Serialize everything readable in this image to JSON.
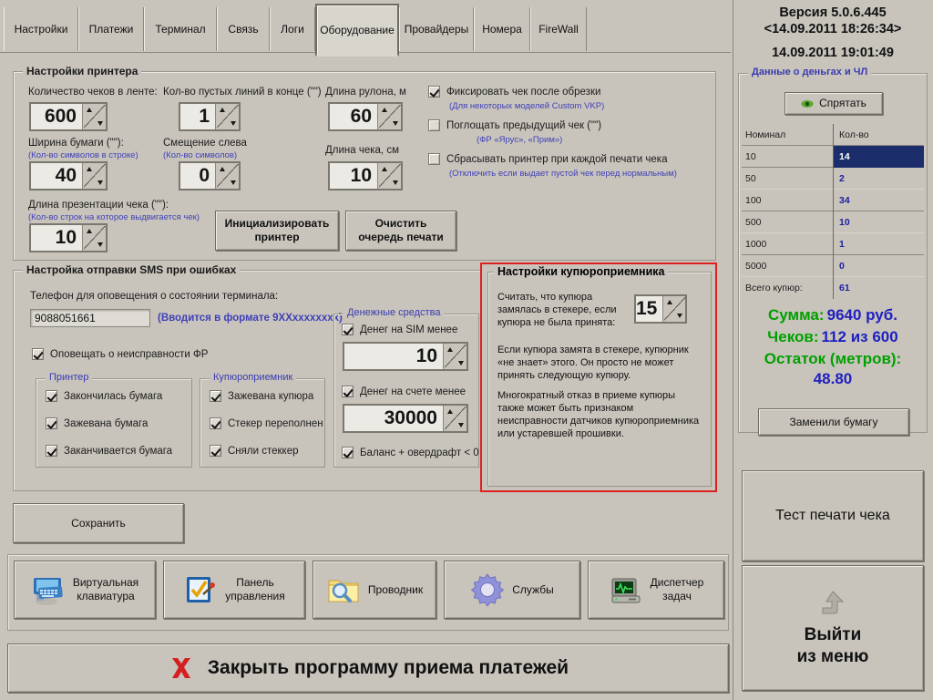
{
  "tabs": [
    {
      "label": "Настройки",
      "selected": false
    },
    {
      "label": "Платежи",
      "selected": false
    },
    {
      "label": "Терминал",
      "selected": false
    },
    {
      "label": "Связь",
      "selected": false
    },
    {
      "label": "Логи",
      "selected": false
    },
    {
      "label": "Оборудование",
      "selected": true
    },
    {
      "label": "Провайдеры",
      "selected": false
    },
    {
      "label": "Номера",
      "selected": false
    },
    {
      "label": "FireWall",
      "selected": false
    }
  ],
  "printer": {
    "title": "Настройки принтера",
    "fields": [
      {
        "label": "Количество чеков в ленте:",
        "sub": "",
        "value": "600"
      },
      {
        "label": "Кол-во пустых линий в конце (\"\")",
        "sub": "",
        "value": "1"
      },
      {
        "label": "Длина рулона, м",
        "sub": "",
        "value": "60"
      },
      {
        "label": "Ширина бумаги (\"\"):",
        "sub": "(Кол-во символов в строке)",
        "value": "40"
      },
      {
        "label": "Смещение слева",
        "sub": "(Кол-во символов)",
        "value": "0"
      },
      {
        "label": "Длина чека, см",
        "sub": "",
        "value": "10"
      },
      {
        "label": "Длина презентации чека (\"\"):",
        "sub": "(Кол-во строк на которое выдвигается чек)",
        "value": "10"
      }
    ],
    "checks": [
      {
        "label": "Фиксировать чек после обрезки",
        "sub": "(Для некоторых моделей Custom VKP)",
        "checked": true
      },
      {
        "label": "Поглощать предыдущий чек (\"\")",
        "sub": "(ФР «Ярус», «Прим»)",
        "checked": false
      },
      {
        "label": "Сбрасывать принтер при каждой печати чека",
        "sub": "(Отключить если выдает пустой чек перед нормальным)",
        "checked": false
      }
    ],
    "init_button": "Инициализировать\nпринтер",
    "clear_button": "Очистить\nочередь печати"
  },
  "sms": {
    "title": "Настройка отправки SMS при ошибках",
    "phone_label": "Телефон для оповещения о состоянии терминала:",
    "phone_value": "9088051661",
    "phone_hint": "(Вводится в формате 9ХХхххххххх)",
    "notify_fr": {
      "label": "Оповещать о неисправности ФР",
      "checked": true
    },
    "printer_group": {
      "title": "Принтер",
      "items": [
        {
          "label": "Закончилась бумага",
          "checked": true
        },
        {
          "label": "Зажевана бумага",
          "checked": true
        },
        {
          "label": "Заканчивается бумага",
          "checked": true
        }
      ]
    },
    "acceptor_group": {
      "title": "Купюроприемник",
      "items": [
        {
          "label": "Зажевана купюра",
          "checked": true
        },
        {
          "label": "Стекер переполнен",
          "checked": true
        },
        {
          "label": "Сняли стеккер",
          "checked": true
        }
      ]
    },
    "money_group": {
      "title": "Денежные средства",
      "sim_check": {
        "label": "Денег на SIM менее",
        "checked": true
      },
      "sim_value": "10",
      "account_check": {
        "label": "Денег на счете менее",
        "checked": true
      },
      "account_value": "30000",
      "overdraft": {
        "label": "Баланс + овердрафт < 0",
        "checked": true
      }
    }
  },
  "acceptor_panel": {
    "title": "Настройки купюроприемника",
    "text1": "Считать, что купюра\nзамялась в стекере, если\nкупюра не была принята:",
    "value": "15",
    "text2": "Если купюра замята в стекере, купюрник\n«не знает» этого. Он просто не может\nпринять следующую купюру.",
    "text3": "Многократный отказ в приеме купюры\nтакже может быть признаком\nнеисправности датчиков купюроприемника\nили устаревшей прошивки."
  },
  "save_button": "Сохранить",
  "toolbar": [
    {
      "label": "Виртуальная\nклавиатура",
      "icon": "keyboard-icon"
    },
    {
      "label": "Панель\nуправления",
      "icon": "control-panel-icon"
    },
    {
      "label": "Проводник",
      "icon": "explorer-folder-icon"
    },
    {
      "label": "Службы",
      "icon": "gear-icon"
    },
    {
      "label": "Диспетчер\nзадач",
      "icon": "task-manager-icon"
    }
  ],
  "close_button": "Закрыть программу приема платежей",
  "sidebar": {
    "version": "Версия 5.0.6.445",
    "build_date": "<14.09.2011 18:26:34>",
    "clock": "14.09.2011 19:01:49",
    "money_group_title": "Данные о деньгах и ЧЛ",
    "hide_button": "Спрятать",
    "table": {
      "headers": [
        "Номинал",
        "Кол-во"
      ],
      "rows": [
        {
          "denom": "10",
          "count": "14",
          "selected": true
        },
        {
          "denom": "50",
          "count": "2",
          "selected": false
        },
        {
          "denom": "100",
          "count": "34",
          "selected": false
        },
        {
          "denom": "500",
          "count": "10",
          "selected": false
        },
        {
          "denom": "1000",
          "count": "1",
          "selected": false
        },
        {
          "denom": "5000",
          "count": "0",
          "selected": false
        }
      ],
      "total_label": "Всего купюр:",
      "total_value": "61"
    },
    "sum_label": "Сумма:",
    "sum_value": "9640 руб.",
    "checks_label": "Чеков:",
    "checks_value": "112 из 600",
    "remain_label": "Остаток (метров):",
    "remain_value": "48.80",
    "paper_button": "Заменили бумагу",
    "test_print_button": "Тест печати чека",
    "exit_button": "Выйти\nиз меню"
  },
  "colors": {
    "face": "#c8c4bc",
    "accent_blue": "#4040b8",
    "green": "#00a000",
    "value_blue": "#2020c0",
    "alert_red": "#e02020",
    "selection": "#1b2d6b"
  }
}
